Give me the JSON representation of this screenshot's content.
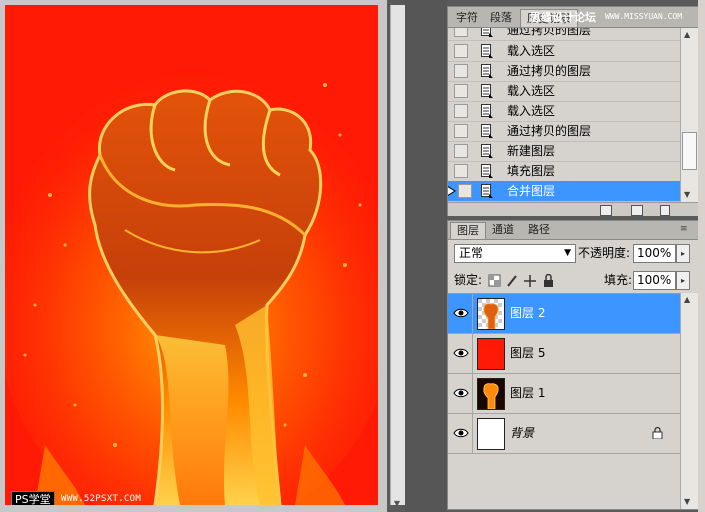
{
  "canvas": {
    "watermark_logo": "PS学堂",
    "watermark_site": "WWW.52PSXT.COM",
    "background_color": "#ff1a05"
  },
  "history_panel": {
    "tabs": [
      {
        "label": "字符"
      },
      {
        "label": "段落"
      },
      {
        "label": "历史记录",
        "active": true
      }
    ],
    "watermark": "思缘设计论坛",
    "watermark_site": "WWW.MISSYUAN.COM",
    "items": [
      {
        "label": "通过拷贝的图层"
      },
      {
        "label": "载入选区"
      },
      {
        "label": "通过拷贝的图层"
      },
      {
        "label": "载入选区"
      },
      {
        "label": "载入选区"
      },
      {
        "label": "通过拷贝的图层"
      },
      {
        "label": "新建图层"
      },
      {
        "label": "填充图层"
      },
      {
        "label": "合并图层",
        "selected": true
      }
    ],
    "footer_icons": [
      "new-document-icon",
      "camera-icon",
      "trash-icon"
    ]
  },
  "layers_panel": {
    "tabs": [
      {
        "label": "图层",
        "active": true
      },
      {
        "label": "通道"
      },
      {
        "label": "路径"
      }
    ],
    "blend_mode": "正常",
    "opacity_label": "不透明度:",
    "opacity_value": "100%",
    "lock_label": "锁定:",
    "fill_label": "填充:",
    "fill_value": "100%",
    "layers": [
      {
        "name": "图层 2",
        "selected": true,
        "thumb": "fist-transparent"
      },
      {
        "name": "图层 5",
        "thumb": "red-fill"
      },
      {
        "name": "图层 1",
        "thumb": "fist-dark"
      },
      {
        "name": "背景",
        "thumb": "white-fill",
        "locked": true,
        "italic": true
      }
    ],
    "accent_color": "#3d95ff"
  }
}
